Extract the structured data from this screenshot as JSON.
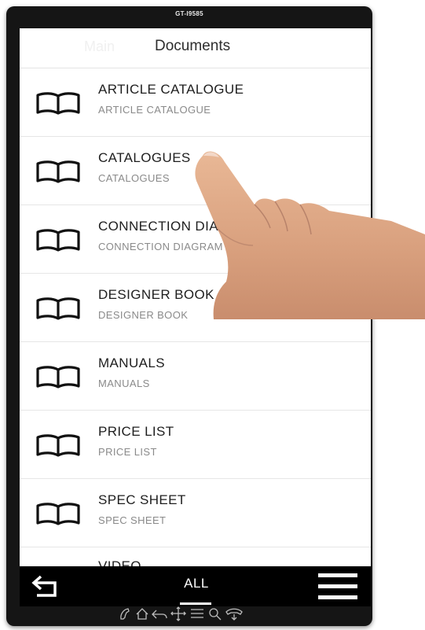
{
  "device": {
    "model": "GT-I9585"
  },
  "nav": {
    "back_label": "Main",
    "title": "Documents"
  },
  "items": [
    {
      "title": "ARTICLE CATALOGUE",
      "subtitle": "ARTICLE CATALOGUE",
      "icon": "book-icon"
    },
    {
      "title": "CATALOGUES",
      "subtitle": "CATALOGUES",
      "icon": "book-icon"
    },
    {
      "title": "CONNECTION DIAGRAM",
      "subtitle": "CONNECTION DIAGRAM",
      "icon": "book-icon"
    },
    {
      "title": "DESIGNER BOOK",
      "subtitle": "DESIGNER BOOK",
      "icon": "book-icon"
    },
    {
      "title": "MANUALS",
      "subtitle": "MANUALS",
      "icon": "book-icon"
    },
    {
      "title": "PRICE LIST",
      "subtitle": "PRICE LIST",
      "icon": "book-icon"
    },
    {
      "title": "SPEC SHEET",
      "subtitle": "SPEC SHEET",
      "icon": "book-icon"
    },
    {
      "title": "VIDEO",
      "subtitle": "",
      "icon": "book-icon"
    }
  ],
  "bottom_bar": {
    "tab_label": "ALL",
    "back_icon": "return-arrow-icon",
    "menu_icon": "hamburger-menu-icon"
  },
  "hardware_bar": {
    "icons": [
      "call-icon",
      "home-icon",
      "back-icon",
      "move-icon",
      "list-icon",
      "search-icon",
      "hang-up-icon"
    ]
  }
}
